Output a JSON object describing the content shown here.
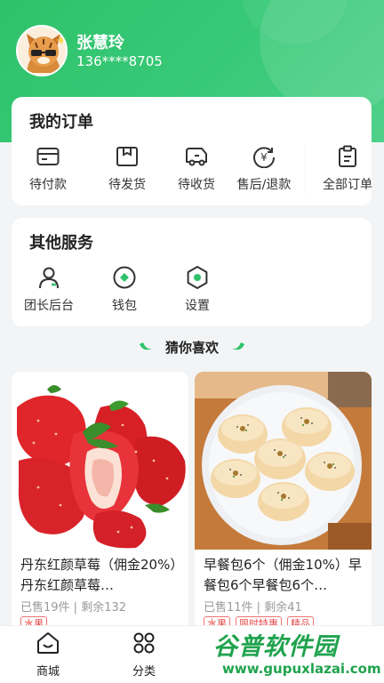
{
  "user": {
    "name": "张慧玲",
    "phone": "136****8705"
  },
  "orders": {
    "title": "我的订单",
    "items": [
      {
        "label": "待付款",
        "icon": "card-icon"
      },
      {
        "label": "待发货",
        "icon": "box-icon"
      },
      {
        "label": "待收货",
        "icon": "truck-icon"
      },
      {
        "label": "售后/退款",
        "icon": "refund-icon"
      },
      {
        "label": "全部订单",
        "icon": "clipboard-icon"
      }
    ]
  },
  "services": {
    "title": "其他服务",
    "items": [
      {
        "label": "团长后台",
        "icon": "person-icon"
      },
      {
        "label": "钱包",
        "icon": "wallet-icon"
      },
      {
        "label": "设置",
        "icon": "gear-icon"
      }
    ]
  },
  "recommend_title": "猜你喜欢",
  "products": [
    {
      "title": "丹东红颜草莓（佣金20%）丹东红颜草莓…",
      "sold": "已售19件",
      "remain": "剩余132",
      "tags": [
        "水果"
      ]
    },
    {
      "title": "早餐包6个（佣金10%）早餐包6个早餐包6个…",
      "sold": "已售11件",
      "remain": "剩余41",
      "tags": [
        "水果",
        "限时特惠",
        "精品"
      ]
    }
  ],
  "tabbar": [
    {
      "label": "商城",
      "icon": "home-icon"
    },
    {
      "label": "分类",
      "icon": "category-icon"
    }
  ],
  "watermark": {
    "main": "谷普软件园",
    "sub": "www.gupuxlazai.com"
  },
  "colors": {
    "brand": "#2fc26a",
    "tag": "#e84b4b"
  }
}
